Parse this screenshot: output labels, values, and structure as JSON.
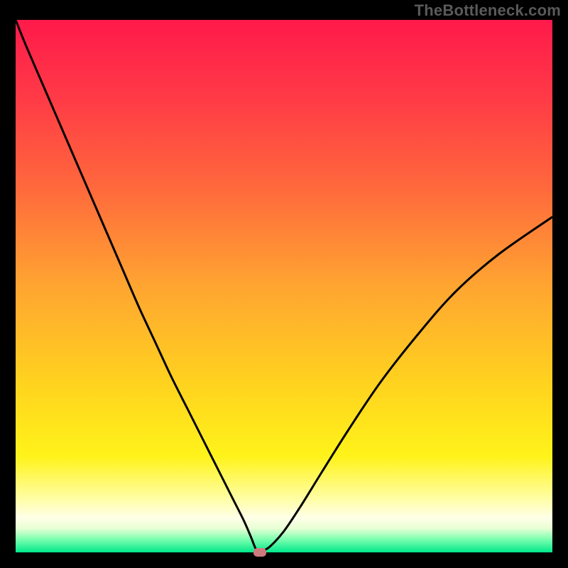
{
  "watermark": "TheBottleneck.com",
  "chart_data": {
    "type": "line",
    "title": "",
    "xlabel": "",
    "ylabel": "",
    "xlim": [
      0,
      100
    ],
    "ylim": [
      0,
      100
    ],
    "grid": false,
    "legend": false,
    "gradient_stops": [
      {
        "offset": 0.0,
        "color": "#ff1a4b"
      },
      {
        "offset": 0.15,
        "color": "#ff3b46"
      },
      {
        "offset": 0.32,
        "color": "#ff6a3c"
      },
      {
        "offset": 0.5,
        "color": "#ffa531"
      },
      {
        "offset": 0.68,
        "color": "#ffd21f"
      },
      {
        "offset": 0.82,
        "color": "#fff31a"
      },
      {
        "offset": 0.9,
        "color": "#fffea6"
      },
      {
        "offset": 0.935,
        "color": "#ffffe8"
      },
      {
        "offset": 0.955,
        "color": "#e8ffd4"
      },
      {
        "offset": 0.975,
        "color": "#7dffb0"
      },
      {
        "offset": 1.0,
        "color": "#00e88a"
      }
    ],
    "series": [
      {
        "name": "bottleneck-curve",
        "x": [
          0,
          2,
          5,
          8,
          11,
          14,
          17,
          20,
          23,
          26,
          29,
          32,
          35,
          38,
          40.5,
          42.5,
          43.8,
          44.5,
          45,
          46,
          47.5,
          50,
          53,
          57,
          62,
          68,
          75,
          82,
          90,
          100
        ],
        "y": [
          100,
          95,
          88,
          81,
          74,
          67,
          60,
          53,
          46,
          39.5,
          33,
          27,
          21,
          15,
          10,
          6,
          3,
          1.2,
          0.3,
          0.3,
          1.2,
          4,
          8.5,
          15,
          23,
          32,
          41,
          49,
          56,
          63
        ]
      }
    ],
    "marker": {
      "name": "optimal-point",
      "x": 45.5,
      "y": 0.0,
      "color": "#cf7a7f"
    }
  }
}
